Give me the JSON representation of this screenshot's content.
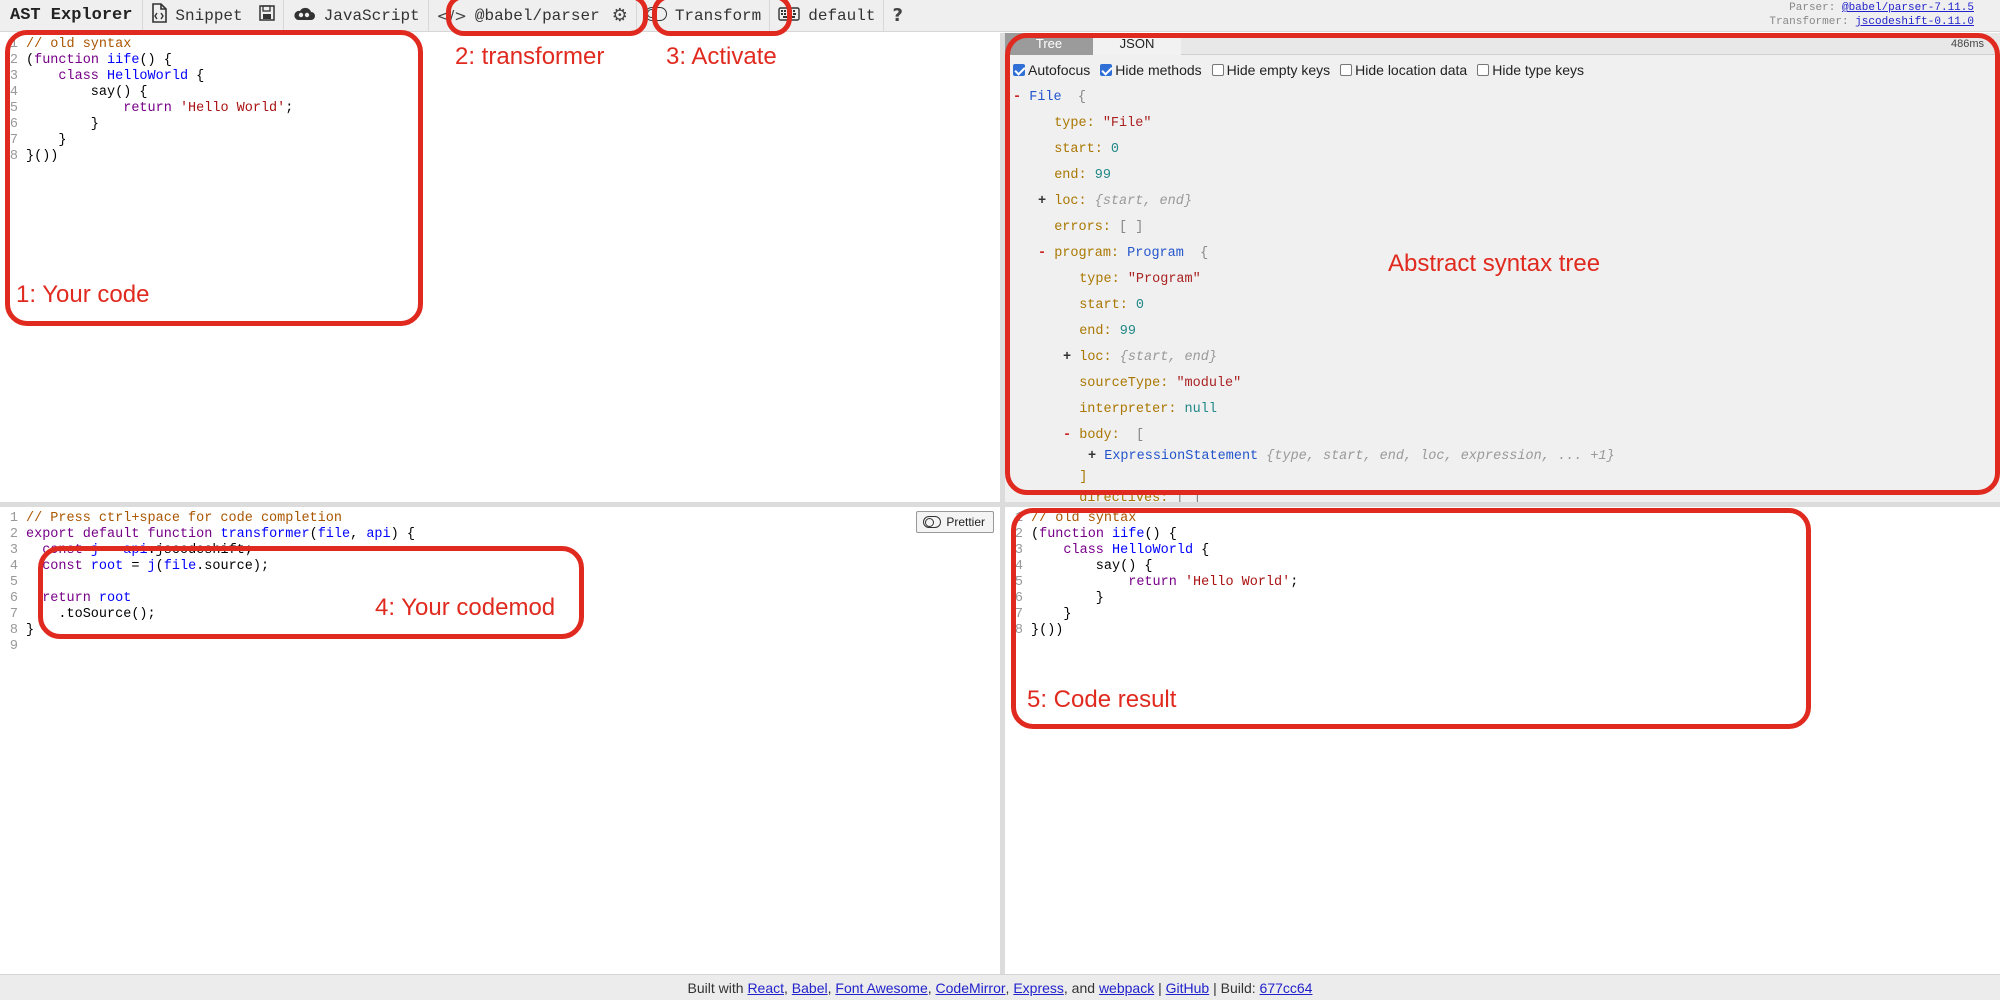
{
  "toolbar": {
    "app_title": "AST Explorer",
    "snippet_label": "Snippet",
    "language_label": "JavaScript",
    "parser_label": "@babel/parser",
    "transform_label": "Transform",
    "keymap_label": "default",
    "help_label": "?",
    "parser_info_prefix": "Parser:",
    "parser_version": "@babel/parser-7.11.5",
    "transformer_info_prefix": "Transformer:",
    "transformer_version": "jscodeshift-0.11.0"
  },
  "source_code": {
    "lines": [
      {
        "n": "1",
        "parts": [
          {
            "t": "// old syntax",
            "c": "comment"
          }
        ]
      },
      {
        "n": "2",
        "parts": [
          {
            "t": "(",
            "c": ""
          },
          {
            "t": "function",
            "c": "kw"
          },
          {
            "t": " ",
            "c": ""
          },
          {
            "t": "iife",
            "c": "def"
          },
          {
            "t": "() {",
            "c": ""
          }
        ]
      },
      {
        "n": "3",
        "parts": [
          {
            "t": "    ",
            "c": ""
          },
          {
            "t": "class",
            "c": "kw"
          },
          {
            "t": " ",
            "c": ""
          },
          {
            "t": "HelloWorld",
            "c": "def"
          },
          {
            "t": " {",
            "c": ""
          }
        ]
      },
      {
        "n": "4",
        "parts": [
          {
            "t": "        say() {",
            "c": ""
          }
        ]
      },
      {
        "n": "5",
        "parts": [
          {
            "t": "            ",
            "c": ""
          },
          {
            "t": "return",
            "c": "kw"
          },
          {
            "t": " ",
            "c": ""
          },
          {
            "t": "'Hello World'",
            "c": "str"
          },
          {
            "t": ";",
            "c": ""
          }
        ]
      },
      {
        "n": "6",
        "parts": [
          {
            "t": "        }",
            "c": ""
          }
        ]
      },
      {
        "n": "7",
        "parts": [
          {
            "t": "    }",
            "c": ""
          }
        ]
      },
      {
        "n": "8",
        "parts": [
          {
            "t": "}())",
            "c": ""
          }
        ]
      }
    ]
  },
  "ast_panel": {
    "tabs": [
      "Tree",
      "JSON"
    ],
    "active_tab": "Tree",
    "timing": "486ms",
    "options": [
      {
        "label": "Autofocus",
        "checked": true
      },
      {
        "label": "Hide methods",
        "checked": true
      },
      {
        "label": "Hide empty keys",
        "checked": false
      },
      {
        "label": "Hide location data",
        "checked": false
      },
      {
        "label": "Hide type keys",
        "checked": false
      }
    ],
    "tree": [
      {
        "tog": "-",
        "key": "",
        "type": "File",
        "brace": "{",
        "value": "",
        "vtype": "",
        "indent": 0
      },
      {
        "tog": "",
        "key": "type:",
        "value": "\"File\"",
        "vtype": "str",
        "indent": 1
      },
      {
        "tog": "",
        "key": "start:",
        "value": "0",
        "vtype": "num",
        "indent": 1
      },
      {
        "tog": "",
        "key": "end:",
        "value": "99",
        "vtype": "num",
        "indent": 1
      },
      {
        "tog": "+",
        "key": "loc:",
        "value": "{start, end}",
        "vtype": "gray",
        "indent": 1
      },
      {
        "tog": "",
        "key": "errors:",
        "value": "[ ]",
        "vtype": "punc",
        "indent": 1
      },
      {
        "tog": "-",
        "key": "program:",
        "type": "Program",
        "brace": "{",
        "value": "",
        "vtype": "",
        "indent": 1
      },
      {
        "tog": "",
        "key": "type:",
        "value": "\"Program\"",
        "vtype": "str",
        "indent": 2
      },
      {
        "tog": "",
        "key": "start:",
        "value": "0",
        "vtype": "num",
        "indent": 2
      },
      {
        "tog": "",
        "key": "end:",
        "value": "99",
        "vtype": "num",
        "indent": 2
      },
      {
        "tog": "+",
        "key": "loc:",
        "value": "{start, end}",
        "vtype": "gray",
        "indent": 2
      },
      {
        "tog": "",
        "key": "sourceType:",
        "value": "\"module\"",
        "vtype": "str",
        "indent": 2
      },
      {
        "tog": "",
        "key": "interpreter:",
        "value": "null",
        "vtype": "num",
        "indent": 2
      },
      {
        "tog": "-",
        "key": "body:",
        "type": "",
        "brace": "[",
        "value": "",
        "vtype": "",
        "indent": 2
      },
      {
        "tog": "+",
        "key": "",
        "type": "ExpressionStatement",
        "brace": "",
        "value": "{type, start, end, loc, expression, ... +1}",
        "vtype": "gray",
        "indent": 3
      },
      {
        "tog": "",
        "key": "]",
        "value": "",
        "vtype": "",
        "indent": 2
      },
      {
        "tog": "",
        "key": "directives:",
        "value": "[ ]",
        "vtype": "punc",
        "indent": 2
      }
    ]
  },
  "codemod": {
    "prettier_label": "Prettier",
    "lines": [
      {
        "n": "1",
        "parts": [
          {
            "t": "// Press ctrl+space for code completion",
            "c": "comment"
          }
        ]
      },
      {
        "n": "2",
        "parts": [
          {
            "t": "export",
            "c": "kw"
          },
          {
            "t": " ",
            "c": ""
          },
          {
            "t": "default",
            "c": "kw"
          },
          {
            "t": " ",
            "c": ""
          },
          {
            "t": "function",
            "c": "kw"
          },
          {
            "t": " ",
            "c": ""
          },
          {
            "t": "transformer",
            "c": "def"
          },
          {
            "t": "(",
            "c": ""
          },
          {
            "t": "file",
            "c": "def"
          },
          {
            "t": ", ",
            "c": ""
          },
          {
            "t": "api",
            "c": "def"
          },
          {
            "t": ") {",
            "c": ""
          }
        ]
      },
      {
        "n": "3",
        "parts": [
          {
            "t": "  ",
            "c": ""
          },
          {
            "t": "const",
            "c": "kw"
          },
          {
            "t": " ",
            "c": ""
          },
          {
            "t": "j",
            "c": "def"
          },
          {
            "t": " = ",
            "c": ""
          },
          {
            "t": "api",
            "c": "def"
          },
          {
            "t": ".jscodeshift;",
            "c": ""
          }
        ]
      },
      {
        "n": "4",
        "parts": [
          {
            "t": "  ",
            "c": ""
          },
          {
            "t": "const",
            "c": "kw"
          },
          {
            "t": " ",
            "c": ""
          },
          {
            "t": "root",
            "c": "def"
          },
          {
            "t": " = ",
            "c": ""
          },
          {
            "t": "j",
            "c": "def"
          },
          {
            "t": "(",
            "c": ""
          },
          {
            "t": "file",
            "c": "def"
          },
          {
            "t": ".source);",
            "c": ""
          }
        ]
      },
      {
        "n": "5",
        "parts": [
          {
            "t": "",
            "c": ""
          }
        ]
      },
      {
        "n": "6",
        "parts": [
          {
            "t": "  ",
            "c": ""
          },
          {
            "t": "return",
            "c": "kw"
          },
          {
            "t": " ",
            "c": ""
          },
          {
            "t": "root",
            "c": "def"
          }
        ]
      },
      {
        "n": "7",
        "parts": [
          {
            "t": "    .toSource();",
            "c": ""
          }
        ]
      },
      {
        "n": "8",
        "parts": [
          {
            "t": "}",
            "c": ""
          }
        ]
      },
      {
        "n": "9",
        "parts": [
          {
            "t": "",
            "c": ""
          }
        ]
      }
    ]
  },
  "result_code": {
    "lines": [
      {
        "n": "1",
        "parts": [
          {
            "t": "// old syntax",
            "c": "comment"
          }
        ]
      },
      {
        "n": "2",
        "parts": [
          {
            "t": "(",
            "c": ""
          },
          {
            "t": "function",
            "c": "kw"
          },
          {
            "t": " ",
            "c": ""
          },
          {
            "t": "iife",
            "c": "def"
          },
          {
            "t": "() {",
            "c": ""
          }
        ]
      },
      {
        "n": "3",
        "parts": [
          {
            "t": "    ",
            "c": ""
          },
          {
            "t": "class",
            "c": "kw"
          },
          {
            "t": " ",
            "c": ""
          },
          {
            "t": "HelloWorld",
            "c": "def"
          },
          {
            "t": " {",
            "c": ""
          }
        ]
      },
      {
        "n": "4",
        "parts": [
          {
            "t": "        say() {",
            "c": ""
          }
        ]
      },
      {
        "n": "5",
        "parts": [
          {
            "t": "            ",
            "c": ""
          },
          {
            "t": "return",
            "c": "kw"
          },
          {
            "t": " ",
            "c": ""
          },
          {
            "t": "'Hello World'",
            "c": "str"
          },
          {
            "t": ";",
            "c": ""
          }
        ]
      },
      {
        "n": "6",
        "parts": [
          {
            "t": "        }",
            "c": ""
          }
        ]
      },
      {
        "n": "7",
        "parts": [
          {
            "t": "    }",
            "c": ""
          }
        ]
      },
      {
        "n": "8",
        "parts": [
          {
            "t": "}())",
            "c": ""
          }
        ]
      }
    ]
  },
  "annotations": {
    "your_code": "1: Your code",
    "transformer": "2: transformer",
    "activate": "3: Activate",
    "your_codemod": "4: Your codemod",
    "code_result": "5: Code result",
    "ast": "Abstract syntax tree",
    "color": "#e02a1f"
  },
  "footer": {
    "prefix": "Built with",
    "links": [
      "React",
      "Babel",
      "Font Awesome",
      "CodeMirror",
      "Express"
    ],
    "and_text": ", and",
    "last_link": "webpack",
    "sep": "|",
    "github": "GitHub",
    "build_prefix": "| Build:",
    "build_hash": "677cc64"
  }
}
